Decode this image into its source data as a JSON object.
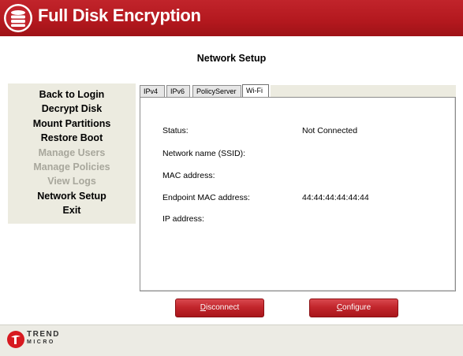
{
  "header": {
    "app_title": "Full Disk Encryption"
  },
  "page_title": "Network Setup",
  "sidebar": {
    "items": [
      {
        "label": "Back to Login",
        "enabled": true
      },
      {
        "label": "Decrypt Disk",
        "enabled": true
      },
      {
        "label": "Mount Partitions",
        "enabled": true
      },
      {
        "label": "Restore Boot",
        "enabled": true
      },
      {
        "label": "Manage Users",
        "enabled": false
      },
      {
        "label": "Manage Policies",
        "enabled": false
      },
      {
        "label": "View Logs",
        "enabled": false
      },
      {
        "label": "Network Setup",
        "enabled": true
      },
      {
        "label": "Exit",
        "enabled": true
      }
    ]
  },
  "tabs": [
    {
      "label": "IPv4"
    },
    {
      "label": "IPv6"
    },
    {
      "label": "PolicyServer"
    },
    {
      "label": "Wi-Fi",
      "active": true
    }
  ],
  "wifi": {
    "status_label": "Status:",
    "status_value": "Not Connected",
    "ssid_label": "Network name (SSID):",
    "ssid_value": "",
    "mac_label": "MAC address:",
    "mac_value": "",
    "endpoint_mac_label": "Endpoint MAC address:",
    "endpoint_mac_value": "44:44:44:44:44:44",
    "ip_label": "IP address:",
    "ip_value": ""
  },
  "buttons": {
    "disconnect_mnemonic": "D",
    "disconnect_rest": "isconnect",
    "configure_mnemonic": "C",
    "configure_rest": "onfigure"
  },
  "footer": {
    "brand_top": "TREND",
    "brand_bottom": "MICRO"
  },
  "colors": {
    "brand_red": "#b3181e",
    "sidebar_bg": "#ecebe0",
    "disabled_text": "#a8a79c"
  }
}
